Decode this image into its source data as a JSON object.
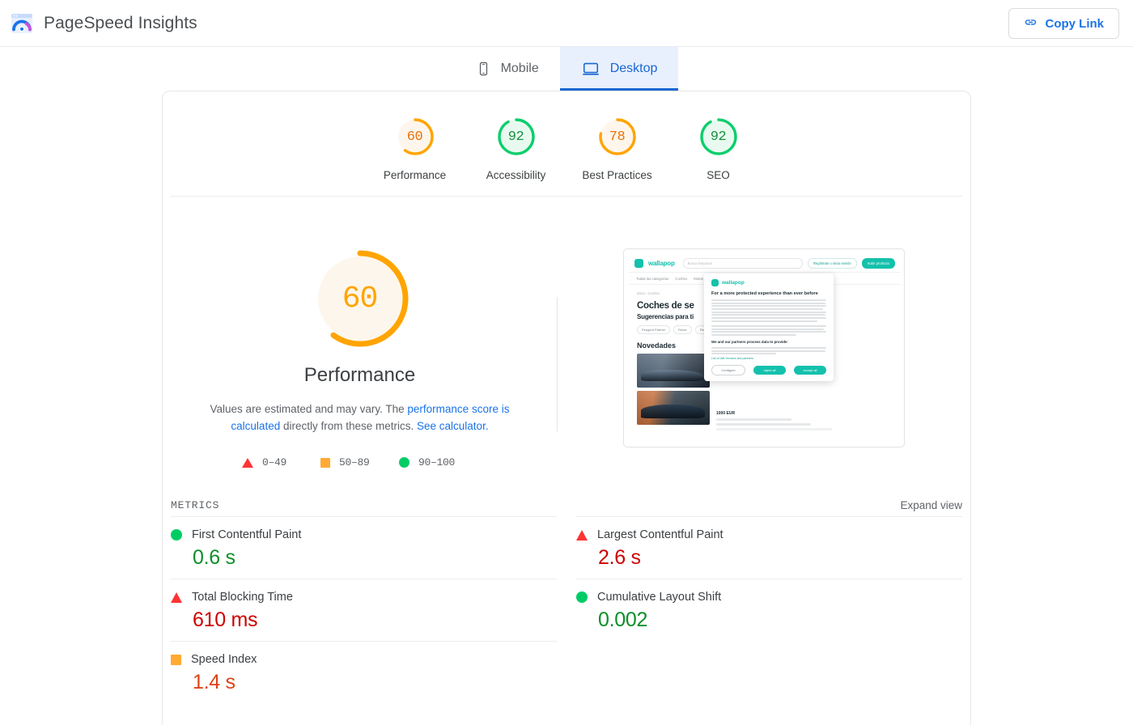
{
  "header": {
    "brand_title": "PageSpeed Insights",
    "logo_icon": "pagespeed-logo-icon",
    "copy_link_label": "Copy Link",
    "copy_link_icon": "link-icon",
    "accent_blue": "#1a73e8"
  },
  "tabs": [
    {
      "label": "Mobile",
      "icon": "mobile-icon",
      "active": false
    },
    {
      "label": "Desktop",
      "icon": "desktop-icon",
      "active": true
    }
  ],
  "scores": [
    {
      "label": "Performance",
      "value": "60",
      "color": "#ffa400",
      "ring_bg": "#fef6ec",
      "num_color": "#e8710a",
      "pct": 60
    },
    {
      "label": "Accessibility",
      "value": "92",
      "color": "#0cce6b",
      "ring_bg": "#e8faf0",
      "num_color": "#178f3f",
      "pct": 92
    },
    {
      "label": "Best Practices",
      "value": "78",
      "color": "#ffa400",
      "ring_bg": "#fef6ec",
      "num_color": "#e8710a",
      "pct": 78
    },
    {
      "label": "SEO",
      "value": "92",
      "color": "#0cce6b",
      "ring_bg": "#e8faf0",
      "num_color": "#178f3f",
      "pct": 92
    }
  ],
  "hero": {
    "gauge_value": "60",
    "gauge_pct": 60,
    "gauge_color": "#ffa400",
    "gauge_fill": "#fdf6ec",
    "title": "Performance",
    "desc_prefix": "Values are estimated and may vary. The ",
    "desc_link1": "performance score is calculated",
    "desc_middle": " directly from these metrics. ",
    "desc_link2": "See calculator."
  },
  "legend": [
    {
      "icon": "triangle-red-icon",
      "range": "0–49",
      "color": "#ff3333"
    },
    {
      "icon": "square-orange-icon",
      "range": "50–89",
      "color": "#ffaa33"
    },
    {
      "icon": "circle-green-icon",
      "range": "90–100",
      "color": "#00cc66"
    }
  ],
  "thumbnail": {
    "site_name": "wallapop",
    "search_placeholder": "Busca lámparas",
    "header_buttons": [
      "Regístrate o inicia sesión",
      "Subir producto"
    ],
    "nav_items": [
      "Todas las categorías",
      "Coches",
      "Motos"
    ],
    "breadcrumb": "Inicio › Coches",
    "heading": "Coches de se",
    "subheading": "Sugerencias para ti",
    "chips": [
      "Peugeot Partner",
      "Rover",
      "Renault"
    ],
    "section_heading": "Novedades",
    "listing_price": "1000 EUR",
    "modal": {
      "logo": "wallapop",
      "title": "For a more protected experience than ever before",
      "subtitle": "We and our partners process data to provide:",
      "link": "List of IAB Vendors and partners",
      "buttons": [
        "Configure",
        "reject all",
        "accept all"
      ]
    }
  },
  "metrics_section": {
    "title": "METRICS",
    "expand_label": "Expand view",
    "left_column": [
      {
        "name": "First Contentful Paint",
        "value": "0.6 s",
        "icon": "circle-green-icon",
        "icon_class": "cir",
        "value_color": "#0a8f28"
      },
      {
        "name": "Total Blocking Time",
        "value": "610 ms",
        "icon": "triangle-red-icon",
        "icon_class": "tri",
        "value_color": "#cc0000"
      },
      {
        "name": "Speed Index",
        "value": "1.4 s",
        "icon": "square-orange-icon",
        "icon_class": "sq",
        "value_color": "#dd4215"
      }
    ],
    "right_column": [
      {
        "name": "Largest Contentful Paint",
        "value": "2.6 s",
        "icon": "triangle-red-icon",
        "icon_class": "tri",
        "value_color": "#cc0000"
      },
      {
        "name": "Cumulative Layout Shift",
        "value": "0.002",
        "icon": "circle-green-icon",
        "icon_class": "cir",
        "value_color": "#0a8f28"
      }
    ]
  }
}
